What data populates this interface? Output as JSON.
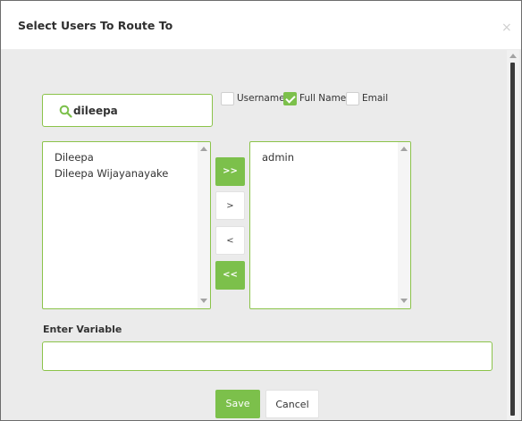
{
  "dialog": {
    "title": "Select Users To Route To",
    "close_glyph": "×"
  },
  "search": {
    "value": "dileepa",
    "icon": "search-icon"
  },
  "filters": [
    {
      "label": "Username",
      "checked": false
    },
    {
      "label": "Full Name",
      "checked": true
    },
    {
      "label": "Email",
      "checked": false
    }
  ],
  "available_list": {
    "items": [
      "Dileepa",
      "Dileepa Wijayanayake"
    ]
  },
  "selected_list": {
    "items": [
      "admin"
    ]
  },
  "move_buttons": {
    "add_all": ">>",
    "add_one": ">",
    "remove_one": "<",
    "remove_all": "<<"
  },
  "variable": {
    "label": "Enter Variable",
    "value": ""
  },
  "footer": {
    "save_label": "Save",
    "cancel_label": "Cancel"
  },
  "colors": {
    "accent": "#7cc04b",
    "border_accent": "#8bc34a"
  }
}
